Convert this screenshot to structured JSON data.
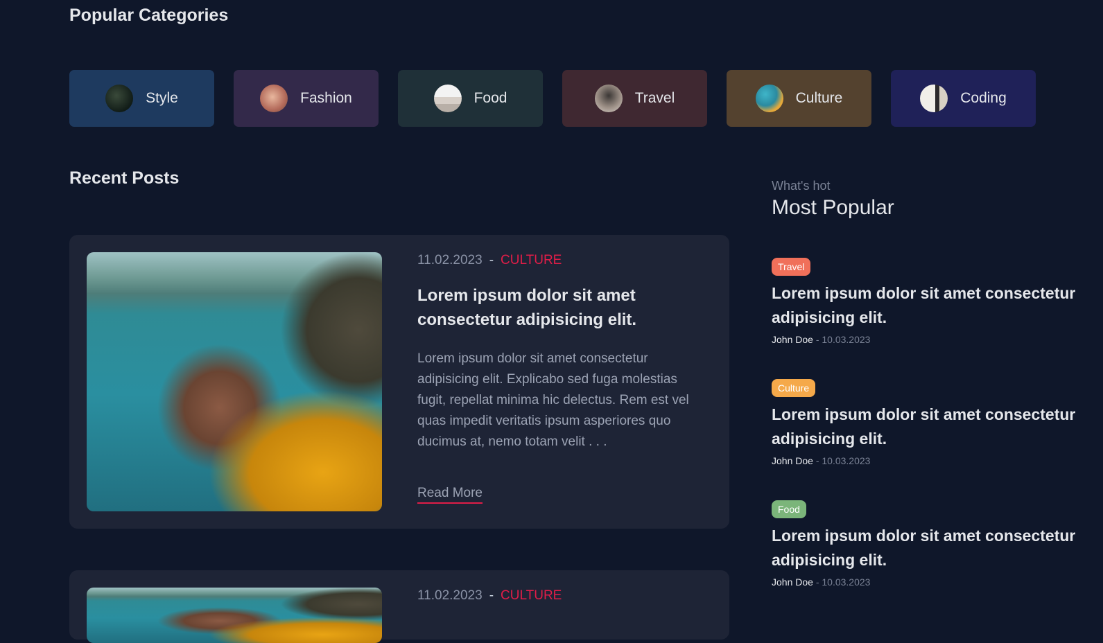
{
  "popular_categories": {
    "title": "Popular Categories",
    "items": [
      {
        "label": "Style",
        "icon": "style-thumbnail-icon"
      },
      {
        "label": "Fashion",
        "icon": "fashion-thumbnail-icon"
      },
      {
        "label": "Food",
        "icon": "food-thumbnail-icon"
      },
      {
        "label": "Travel",
        "icon": "travel-thumbnail-icon"
      },
      {
        "label": "Culture",
        "icon": "culture-thumbnail-icon"
      },
      {
        "label": "Coding",
        "icon": "coding-thumbnail-icon"
      }
    ]
  },
  "recent_posts": {
    "title": "Recent Posts",
    "posts": [
      {
        "date": "11.02.2023",
        "separator": "-",
        "category": "CULTURE",
        "title": "Lorem ipsum dolor sit amet consectetur adipisicing elit.",
        "excerpt": "Lorem ipsum dolor sit amet consectetur adipisicing elit. Explicabo sed fuga molestias fugit, repellat minima hic delectus. Rem est vel quas impedit veritatis ipsum asperiores quo ducimus at, nemo totam velit . . .",
        "read_more": "Read More"
      },
      {
        "date": "11.02.2023",
        "separator": "-",
        "category": "CULTURE"
      }
    ]
  },
  "most_popular": {
    "subtitle": "What's hot",
    "title": "Most Popular",
    "items": [
      {
        "badge": "Travel",
        "badge_color": "#f0705a",
        "title": "Lorem ipsum dolor sit amet consectetur adipisicing elit.",
        "author": "John Doe",
        "date": "- 10.03.2023"
      },
      {
        "badge": "Culture",
        "badge_color": "#f5a94a",
        "title": "Lorem ipsum dolor sit amet consectetur adipisicing elit.",
        "author": "John Doe",
        "date": "- 10.03.2023"
      },
      {
        "badge": "Food",
        "badge_color": "#7bb57a",
        "title": "Lorem ipsum dolor sit amet consectetur adipisicing elit.",
        "author": "John Doe",
        "date": "- 10.03.2023"
      }
    ]
  },
  "colors": {
    "background": "#0f172a",
    "card": "#1e2436",
    "accent": "#e11d48"
  }
}
